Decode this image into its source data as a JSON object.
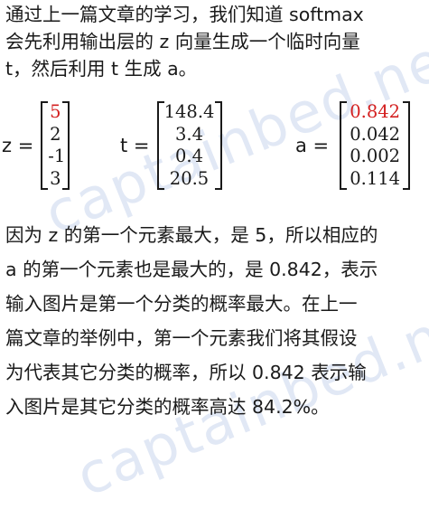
{
  "paragraph1": {
    "lines": [
      "通过上一篇文章的学习，我们知道 softmax",
      "会先利用输出层的 z 向量生成一个临时向量",
      "t，然后利用 t 生成 a。"
    ]
  },
  "equations": {
    "z": {
      "label": "z =",
      "values": [
        "5",
        "2",
        "-1",
        "3"
      ]
    },
    "t": {
      "label": "t =",
      "values": [
        "148.4",
        "3.4",
        "0.4",
        "20.5"
      ]
    },
    "a": {
      "label": "a =",
      "values": [
        "0.842",
        "0.042",
        "0.002",
        "0.114"
      ]
    }
  },
  "paragraph2": {
    "lines": [
      "因为 z 的第一个元素最大，是 5，所以相应的",
      "a 的第一个元素也是最大的，是 0.842，表示",
      "输入图片是第一个分类的概率最大。在上一",
      "篇文章的举例中，第一个元素我们将其假设",
      "为代表其它分类的概率，所以 0.842 表示输",
      "入图片是其它分类的概率高达 84.2%。"
    ]
  },
  "watermark": {
    "text": "captainbed.net"
  },
  "colors": {
    "highlight": "#d42020",
    "text": "#1a1a1a"
  }
}
